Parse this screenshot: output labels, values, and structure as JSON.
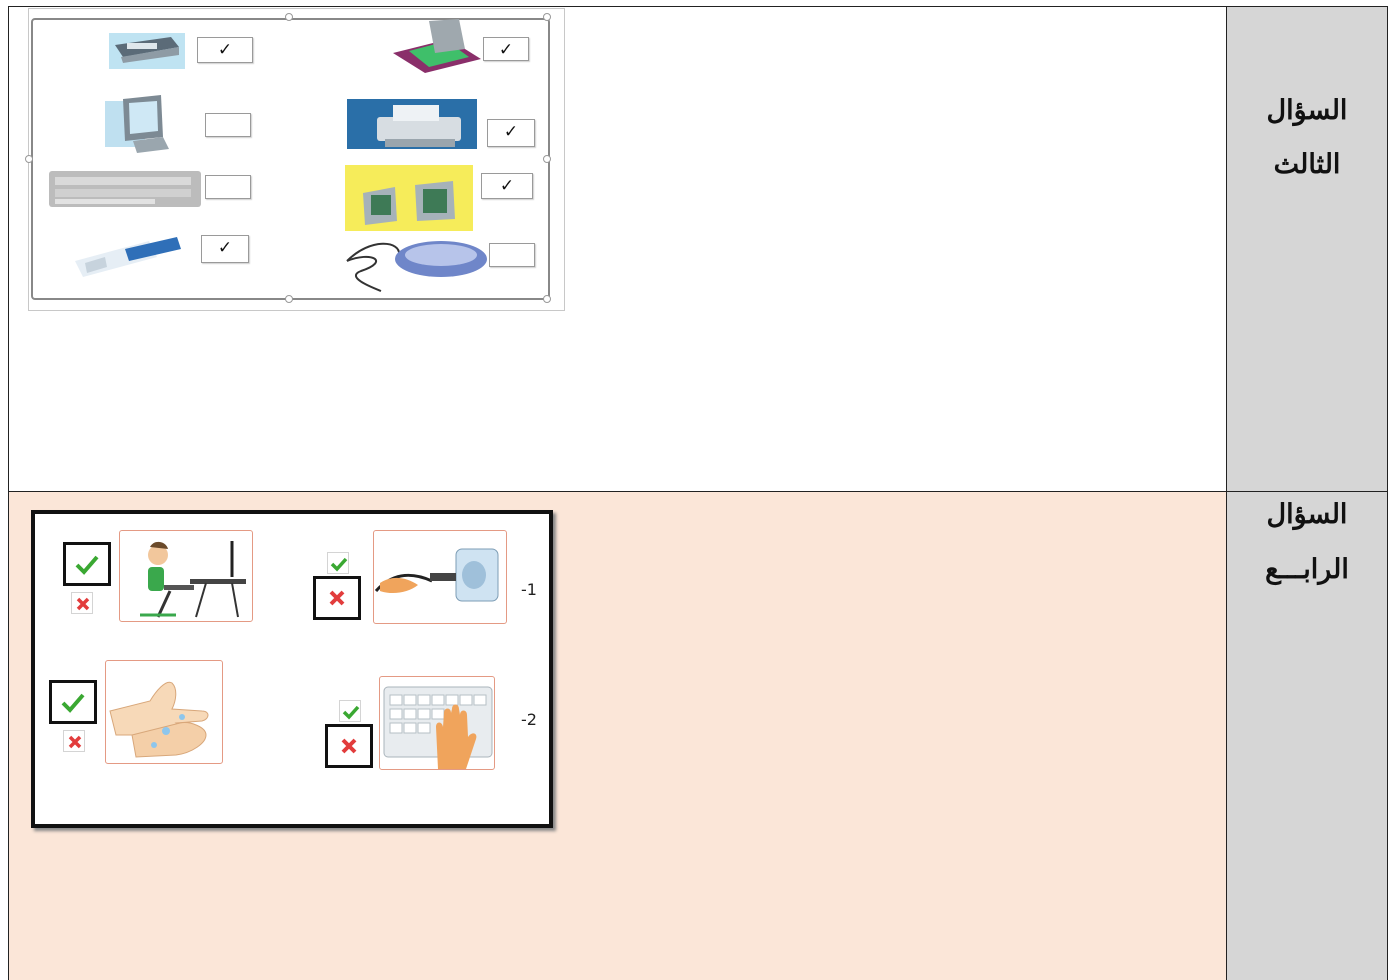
{
  "questions": [
    {
      "label_line1": "السؤال",
      "label_line2": "الثالث",
      "devices": [
        {
          "icon": "scanner-icon",
          "checked": true,
          "check": "✓"
        },
        {
          "icon": "monitor-icon",
          "checked": false,
          "check": ""
        },
        {
          "icon": "keyboard-icon",
          "checked": false,
          "check": ""
        },
        {
          "icon": "usb-flash-icon",
          "checked": true,
          "check": "✓"
        },
        {
          "icon": "flatbed-scanner-icon",
          "checked": true,
          "check": "✓"
        },
        {
          "icon": "printer-icon",
          "checked": true,
          "check": "✓"
        },
        {
          "icon": "computers-icon",
          "checked": true,
          "check": "✓"
        },
        {
          "icon": "mouse-icon",
          "checked": false,
          "check": ""
        }
      ]
    },
    {
      "label_line1": "السؤال",
      "label_line2": "الرابـــع",
      "items": [
        {
          "number": "-1",
          "scene": "plug-in-socket",
          "selected": "wrong"
        },
        {
          "number": "",
          "scene": "sitting-at-computer",
          "selected": "right"
        },
        {
          "number": "-2",
          "scene": "hands-on-keyboard",
          "selected": "wrong"
        },
        {
          "number": "",
          "scene": "washing-hands",
          "selected": "right"
        }
      ]
    }
  ],
  "colors": {
    "row2_bg": "#fbe6d8",
    "label_bg": "#d6d6d6",
    "card_border": "#e49a84",
    "right_mark": "#3aa832",
    "wrong_mark": "#e23c3c"
  }
}
